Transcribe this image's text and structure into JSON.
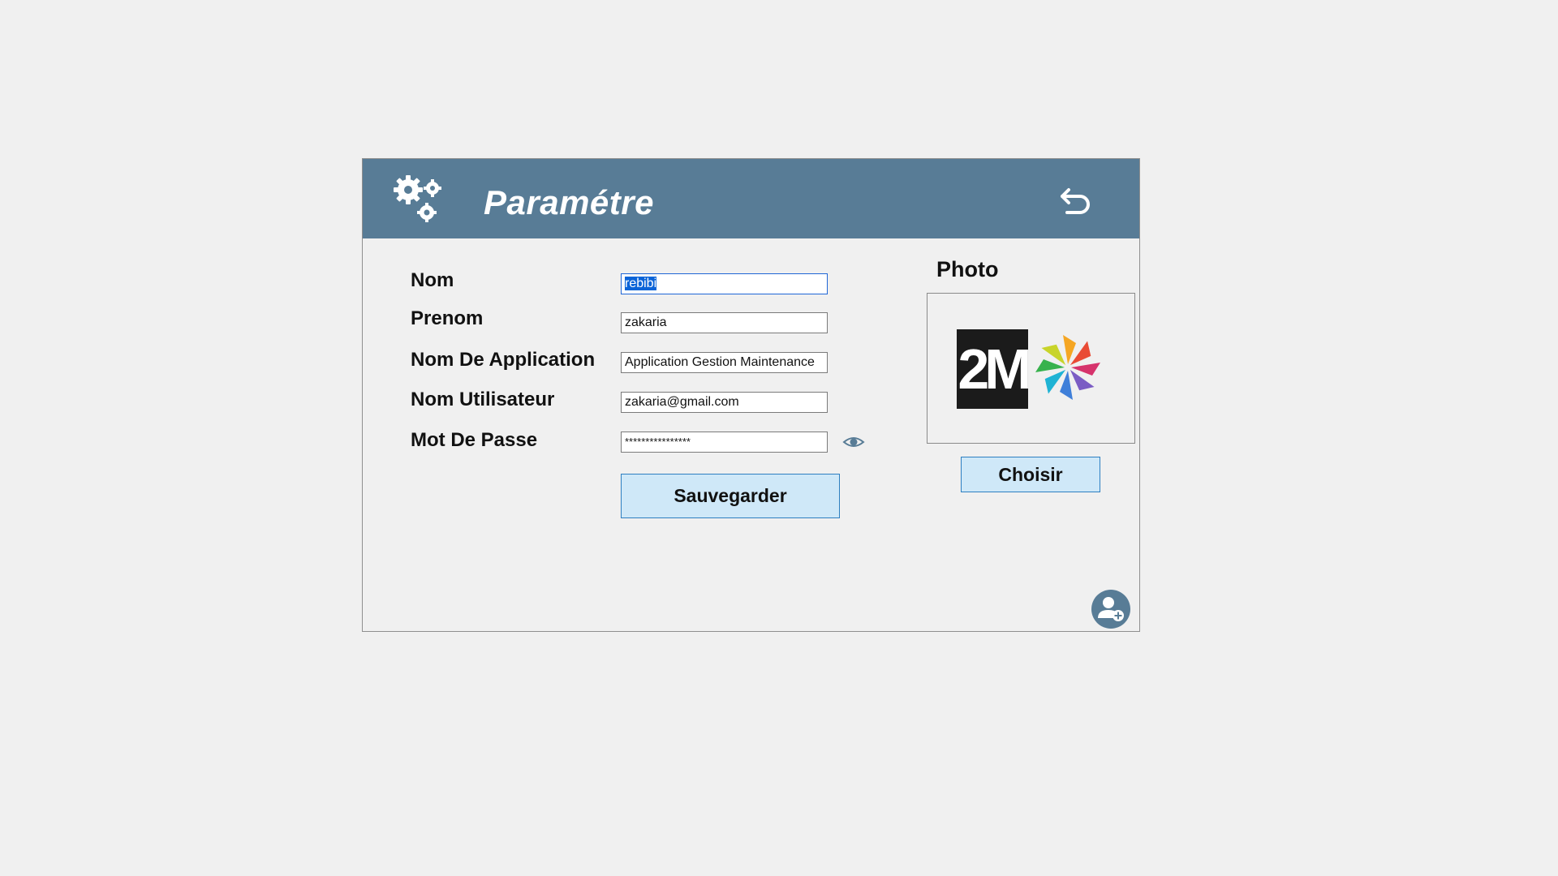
{
  "window": {
    "title": "Paramétre",
    "icons": {
      "settings": "gears-icon",
      "back": "undo-arrow-icon",
      "user": "user-add-icon",
      "eye": "eye-icon"
    }
  },
  "form": {
    "nom": {
      "label": "Nom",
      "value": "rebibi"
    },
    "prenom": {
      "label": "Prenom",
      "value": "zakaria"
    },
    "app_name": {
      "label": "Nom De Application",
      "value": "Application Gestion Maintenance"
    },
    "username": {
      "label": "Nom Utilisateur",
      "value": "zakaria@gmail.com"
    },
    "password": {
      "label": "Mot De Passe",
      "value": "****************"
    },
    "save_label": "Sauvegarder"
  },
  "photo": {
    "label": "Photo",
    "logo_text": "2M",
    "choose_label": "Choisir"
  },
  "colors": {
    "header": "#587c96",
    "button_bg": "#cfe8f8",
    "button_border": "#2d7fc1",
    "selection": "#0b64d8"
  }
}
